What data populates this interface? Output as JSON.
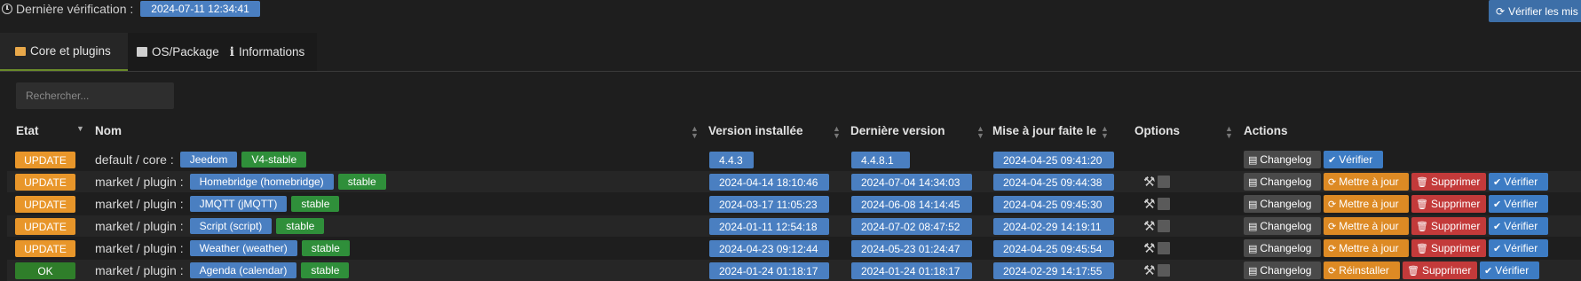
{
  "top": {
    "last_check_label": "Dernière vérification :",
    "last_check_value": "2024-07-11 12:34:41",
    "verify_all_label": "Vérifier les mis"
  },
  "tabs": [
    {
      "label": "Core et plugins",
      "icon": "box-icon"
    },
    {
      "label": "OS/Package",
      "icon": "package-icon"
    },
    {
      "label": "Informations",
      "icon": "info-icon"
    }
  ],
  "search": {
    "placeholder": "Rechercher..."
  },
  "headers": {
    "etat": "Etat",
    "nom": "Nom",
    "version_installee": "Version installée",
    "derniere_version": "Dernière version",
    "mise_a_jour": "Mise à jour faite le",
    "options": "Options",
    "actions": "Actions"
  },
  "labels": {
    "changelog": "Changelog",
    "mettre_a_jour": "Mettre à jour",
    "reinstaller": "Réinstaller",
    "supprimer": "Supprimer",
    "verifier": "Vérifier"
  },
  "rows": [
    {
      "status": "UPDATE",
      "type": "default / core :",
      "name": "Jeedom",
      "branch": "V4-stable",
      "installed": "4.4.3",
      "latest": "4.4.8.1",
      "updated": "2024-04-25 09:41:20"
    },
    {
      "status": "UPDATE",
      "type": "market / plugin :",
      "name": "Homebridge (homebridge)",
      "branch": "stable",
      "installed": "2024-04-14 18:10:46",
      "latest": "2024-07-04 14:34:03",
      "updated": "2024-04-25 09:44:38"
    },
    {
      "status": "UPDATE",
      "type": "market / plugin :",
      "name": "JMQTT (jMQTT)",
      "branch": "stable",
      "installed": "2024-03-17 11:05:23",
      "latest": "2024-06-08 14:14:45",
      "updated": "2024-04-25 09:45:30"
    },
    {
      "status": "UPDATE",
      "type": "market / plugin :",
      "name": "Script (script)",
      "branch": "stable",
      "installed": "2024-01-11 12:54:18",
      "latest": "2024-07-02 08:47:52",
      "updated": "2024-02-29 14:19:11"
    },
    {
      "status": "UPDATE",
      "type": "market / plugin :",
      "name": "Weather (weather)",
      "branch": "stable",
      "installed": "2024-04-23 09:12:44",
      "latest": "2024-05-23 01:24:47",
      "updated": "2024-04-25 09:45:54"
    },
    {
      "status": "OK",
      "type": "market / plugin :",
      "name": "Agenda (calendar)",
      "branch": "stable",
      "installed": "2024-01-24 01:18:17",
      "latest": "2024-01-24 01:18:17",
      "updated": "2024-02-29 14:17:55"
    }
  ],
  "colors": {
    "update": "#e8962a",
    "ok": "#2f7e2a",
    "blue_label": "#4a7fc1",
    "green_label": "#2f8f3a",
    "danger": "#c33a3a"
  }
}
